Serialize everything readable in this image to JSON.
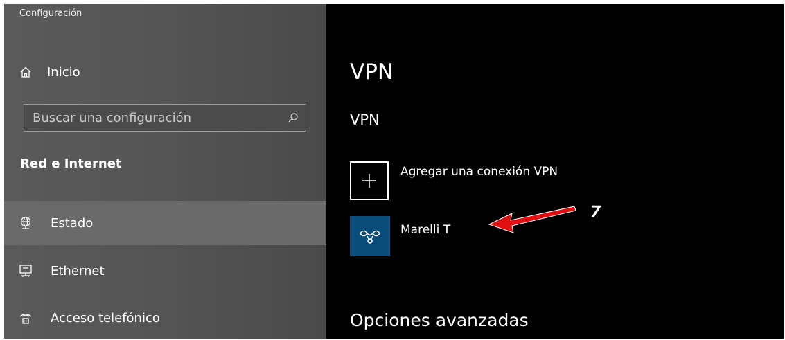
{
  "window": {
    "title": "Configuración"
  },
  "sidebar": {
    "home": {
      "label": "Inicio",
      "icon": "home-icon"
    },
    "search": {
      "placeholder": "Buscar una configuración",
      "icon": "search-icon"
    },
    "section_title": "Red e Internet",
    "items": [
      {
        "label": "Estado",
        "icon": "globe-icon",
        "selected": true
      },
      {
        "label": "Ethernet",
        "icon": "ethernet-icon",
        "selected": false
      },
      {
        "label": "Acceso telefónico",
        "icon": "dialup-icon",
        "selected": false
      }
    ]
  },
  "main": {
    "page_title": "VPN",
    "section_title": "VPN",
    "add_connection_label": "Agregar una conexión VPN",
    "connections": [
      {
        "name": "Marelli T",
        "icon": "vpn-provider-icon"
      }
    ],
    "advanced_title": "Opciones avanzadas"
  },
  "annotation": {
    "step": "7"
  },
  "colors": {
    "sidebar_bg": "#555555",
    "selected_bg": "#6a6a6a",
    "content_bg": "#000000",
    "vpn_tile": "#0b4d7a",
    "arrow": "#e01010"
  }
}
